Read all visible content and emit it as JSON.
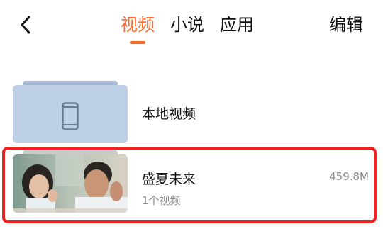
{
  "header": {
    "back_icon": "chevron-left-icon",
    "tabs": [
      {
        "label": "视频",
        "active": true
      },
      {
        "label": "小说",
        "active": false
      },
      {
        "label": "应用",
        "active": false
      }
    ],
    "edit_label": "编辑",
    "accent_color": "#ff6a2a"
  },
  "folders": [
    {
      "title": "本地视频",
      "icon": "phone-icon"
    },
    {
      "title": "盛夏未来",
      "subtitle": "1个视频",
      "size": "459.8M",
      "thumbnail": "movie-still-thumbnail",
      "highlighted": true
    }
  ],
  "highlight_color": "#f02222"
}
